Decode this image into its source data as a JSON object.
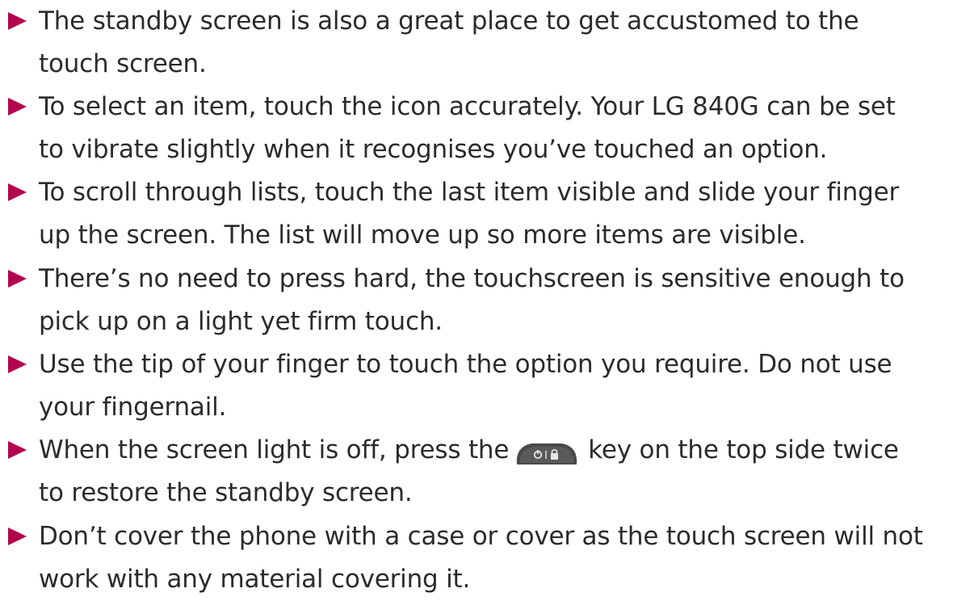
{
  "bullets": [
    {
      "lines": [
        "The standby screen is also a great place to get accustomed to the",
        "touch screen."
      ]
    },
    {
      "lines": [
        "To select an item, touch the icon accurately. Your LG 840G can be set",
        "to vibrate slightly when it recognises you’ve touched an option."
      ]
    },
    {
      "lines": [
        "To scroll through lists, touch the last item visible and slide your finger",
        "up the screen. The list will move up so more items are visible."
      ]
    },
    {
      "lines": [
        "There’s no need to press hard, the touchscreen is sensitive enough to",
        "pick up on a light yet firm touch."
      ]
    },
    {
      "lines": [
        "Use the tip of your finger to touch the option you require. Do not use",
        "your fingernail."
      ]
    },
    {
      "line1_before": "When the screen light is off, press the",
      "key_icon": "power-lock-key-icon",
      "line1_after": "key on the top side twice",
      "line2": "to restore the standby screen."
    },
    {
      "lines": [
        "Don’t cover the phone with a case or cover as the touch screen will not",
        "work with any material covering it."
      ]
    }
  ],
  "colors": {
    "bullet_arrow": "#b3064d",
    "text": "#2b2b2b",
    "key_body": "#4a4a4a"
  }
}
